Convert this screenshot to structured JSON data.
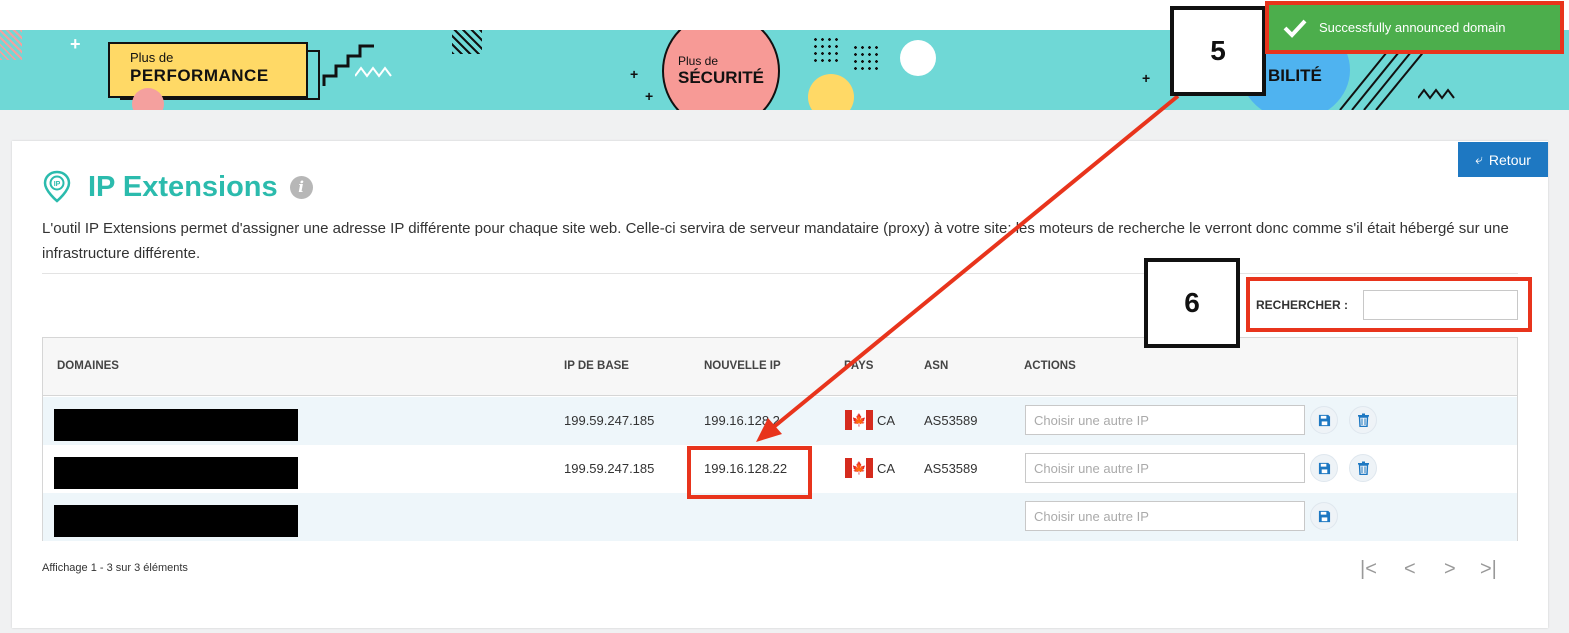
{
  "banner": {
    "perf_small": "Plus de",
    "perf_big": "PERFORMANCE",
    "sec_small": "Plus de",
    "sec_big": "SÉCURITÉ",
    "bil_text": "BILITÉ"
  },
  "toast": {
    "message": "Successfully announced domain",
    "color": "#4cae4c"
  },
  "annotations": {
    "step5": "5",
    "step6": "6",
    "color": "#e8341c"
  },
  "header": {
    "back_label": "Retour",
    "title": "IP Extensions",
    "info_icon": "i",
    "description": "L'outil IP Extensions permet d'assigner une adresse IP différente pour chaque site web. Celle-ci servira de serveur mandataire (proxy) à votre site: les moteurs de recherche le verront donc comme s'il était hébergé sur une infrastructure différente."
  },
  "search": {
    "label": "RECHERCHER :",
    "value": ""
  },
  "table": {
    "columns": [
      "DOMAINES",
      "IP DE BASE",
      "NOUVELLE IP",
      "PAYS",
      "ASN",
      "ACTIONS"
    ],
    "rows": [
      {
        "domain": "",
        "base_ip": "199.59.247.185",
        "new_ip": "199.16.128.2",
        "country": "CA",
        "asn": "AS53589",
        "placeholder": "Choisir une autre IP",
        "has_delete": true
      },
      {
        "domain": "",
        "base_ip": "199.59.247.185",
        "new_ip": "199.16.128.22",
        "country": "CA",
        "asn": "AS53589",
        "placeholder": "Choisir une autre IP",
        "has_delete": true
      },
      {
        "domain": "",
        "base_ip": "",
        "new_ip": "",
        "country": "",
        "asn": "",
        "placeholder": "Choisir une autre IP",
        "has_delete": false
      }
    ]
  },
  "footer": {
    "info": "Affichage 1 - 3 sur 3 éléments",
    "pager": {
      "first": "|<",
      "prev": "<",
      "next": ">",
      "last": ">|"
    }
  }
}
